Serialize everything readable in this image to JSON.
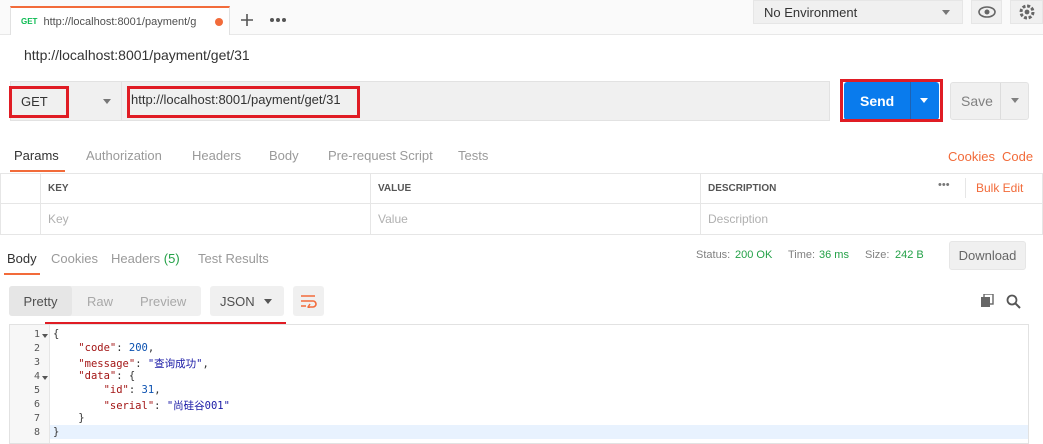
{
  "tabs": {
    "active": {
      "method": "GET",
      "title": "http://localhost:8001/payment/g"
    }
  },
  "environment": {
    "selected": "No Environment"
  },
  "request": {
    "name": "http://localhost:8001/payment/get/31",
    "method": "GET",
    "url": "http://localhost:8001/payment/get/31",
    "send_label": "Send",
    "save_label": "Save"
  },
  "request_tabs": [
    "Params",
    "Authorization",
    "Headers",
    "Body",
    "Pre-request Script",
    "Tests"
  ],
  "request_links": {
    "cookies": "Cookies",
    "code": "Code"
  },
  "params_table": {
    "headers": [
      "KEY",
      "VALUE",
      "DESCRIPTION"
    ],
    "bulk_edit": "Bulk Edit",
    "more": "•••",
    "placeholders": [
      "Key",
      "Value",
      "Description"
    ]
  },
  "response_tabs": {
    "body": "Body",
    "cookies": "Cookies",
    "headers": "Headers",
    "headers_count": "(5)",
    "test_results": "Test Results"
  },
  "response_status": {
    "status_label": "Status:",
    "status_value": "200 OK",
    "time_label": "Time:",
    "time_value": "36 ms",
    "size_label": "Size:",
    "size_value": "242 B",
    "download_label": "Download"
  },
  "view": {
    "modes": [
      "Pretty",
      "Raw",
      "Preview"
    ],
    "format": "JSON"
  },
  "response_body": {
    "line_numbers": [
      "1",
      "2",
      "3",
      "4",
      "5",
      "6",
      "7",
      "8"
    ],
    "lines": [
      "{",
      "    \"code\": 200,",
      "    \"message\": \"查询成功\",",
      "    \"data\": {",
      "        \"id\": 31,",
      "        \"serial\": \"尚硅谷001\"",
      "    }",
      "}"
    ]
  },
  "colors": {
    "accent": "#f26b3a",
    "send": "#097bed",
    "highlight": "#e01c24",
    "ok": "#24a148"
  }
}
